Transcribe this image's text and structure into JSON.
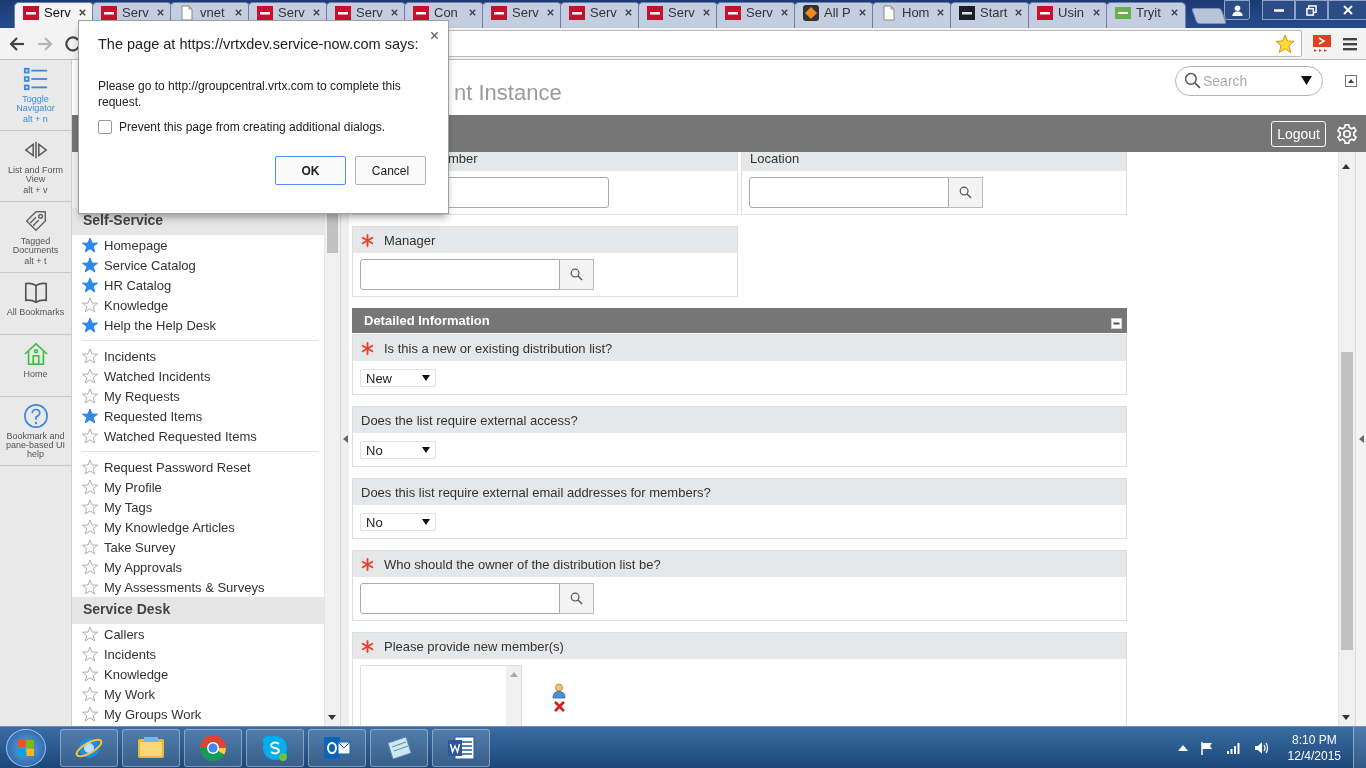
{
  "browser": {
    "tabs": [
      {
        "kind": "now",
        "title": "Serv",
        "selected": true
      },
      {
        "kind": "now",
        "title": "Serv",
        "selected": false
      },
      {
        "kind": "doc",
        "title": "vnet",
        "selected": false
      },
      {
        "kind": "now",
        "title": "Serv",
        "selected": false
      },
      {
        "kind": "now",
        "title": "Serv",
        "selected": false
      },
      {
        "kind": "now",
        "title": "Con",
        "selected": false
      },
      {
        "kind": "now",
        "title": "Serv",
        "selected": false
      },
      {
        "kind": "now",
        "title": "Serv",
        "selected": false
      },
      {
        "kind": "now",
        "title": "Serv",
        "selected": false
      },
      {
        "kind": "now",
        "title": "Serv",
        "selected": false
      },
      {
        "kind": "orange",
        "title": "All P",
        "selected": false
      },
      {
        "kind": "doc",
        "title": "Hom",
        "selected": false
      },
      {
        "kind": "dark",
        "title": "Start",
        "selected": false
      },
      {
        "kind": "now",
        "title": "Usin",
        "selected": false
      },
      {
        "kind": "w3",
        "title": "Tryit",
        "selected": false
      }
    ]
  },
  "dialog": {
    "title": "The page at https://vrtxdev.service-now.com says:",
    "message": "Please go to http://groupcentral.vrtx.com to complete this request.",
    "checkbox": {
      "label": "Prevent this page from creating additional dialogs.",
      "checked": false
    },
    "buttons": [
      {
        "label": "OK",
        "default": true
      },
      {
        "label": "Cancel",
        "default": false
      }
    ]
  },
  "rail": [
    {
      "kind": "list",
      "label": "Toggle Navigator",
      "shortcut": "alt + n",
      "active": true
    },
    {
      "kind": "split",
      "label": "List and Form View",
      "shortcut": "alt + v",
      "active": false
    },
    {
      "kind": "tag",
      "label": "Tagged Documents",
      "shortcut": "alt + t",
      "active": false
    },
    {
      "kind": "book",
      "label": "All Bookmarks",
      "active": false
    },
    {
      "kind": "home",
      "label": "Home",
      "active": false
    },
    {
      "kind": "help",
      "label": "Bookmark and pane-based UI help",
      "active": false
    }
  ],
  "header": {
    "title": "nt Instance",
    "search": {
      "placeholder": "Search"
    },
    "logout": "Logout"
  },
  "navigator": {
    "sections": [
      {
        "title": "Self-Service",
        "groups": [
          {
            "items": [
              {
                "label": "Homepage",
                "favorite": true
              },
              {
                "label": "Service Catalog",
                "favorite": true
              },
              {
                "label": "HR Catalog",
                "favorite": true
              },
              {
                "label": "Knowledge",
                "favorite": false
              },
              {
                "label": "Help the Help Desk",
                "favorite": true
              }
            ]
          },
          {
            "items": [
              {
                "label": "Incidents",
                "favorite": false
              },
              {
                "label": "Watched Incidents",
                "favorite": false
              },
              {
                "label": "My Requests",
                "favorite": false
              },
              {
                "label": "Requested Items",
                "favorite": true
              },
              {
                "label": "Watched Requested Items",
                "favorite": false
              }
            ]
          },
          {
            "items": [
              {
                "label": "Request Password Reset",
                "favorite": false
              },
              {
                "label": "My Profile",
                "favorite": false
              },
              {
                "label": "My Tags",
                "favorite": false
              },
              {
                "label": "My Knowledge Articles",
                "favorite": false
              },
              {
                "label": "Take Survey",
                "favorite": false
              },
              {
                "label": "My Approvals",
                "favorite": false
              },
              {
                "label": "My Assessments & Surveys",
                "favorite": false
              }
            ]
          }
        ]
      },
      {
        "title": "Service Desk",
        "groups": [
          {
            "items": [
              {
                "label": "Callers",
                "favorite": false
              },
              {
                "label": "Incidents",
                "favorite": false
              },
              {
                "label": "Knowledge",
                "favorite": false
              },
              {
                "label": "My Work",
                "favorite": false
              },
              {
                "label": "My Groups Work",
                "favorite": false
              }
            ]
          }
        ]
      }
    ]
  },
  "form": {
    "top_fields": [
      {
        "label": "mber",
        "kind": "text",
        "required": false
      },
      {
        "label": "Location",
        "kind": "reference",
        "required": false
      }
    ],
    "manager": {
      "label": "Manager",
      "kind": "reference",
      "required": true
    },
    "section": {
      "title": "Detailed Information",
      "expanded": true
    },
    "questions": [
      {
        "label": "Is this a new or existing distribution list?",
        "required": true,
        "kind": "select",
        "value": "New"
      },
      {
        "label": "Does the list require external access?",
        "required": false,
        "kind": "select",
        "value": "No"
      },
      {
        "label": "Does this list require external email addresses for members?",
        "required": false,
        "kind": "select",
        "value": "No"
      },
      {
        "label": "Who should the owner of the distribution list be?",
        "required": true,
        "kind": "reference"
      },
      {
        "label": "Please provide new member(s)",
        "required": true,
        "kind": "listbox"
      }
    ]
  },
  "taskbar": {
    "apps": [
      {
        "kind": "ie"
      },
      {
        "kind": "explorer"
      },
      {
        "kind": "chrome"
      },
      {
        "kind": "skype"
      },
      {
        "kind": "outlook"
      },
      {
        "kind": "notepad"
      },
      {
        "kind": "word"
      }
    ],
    "time": "8:10 PM",
    "date": "12/4/2015"
  }
}
